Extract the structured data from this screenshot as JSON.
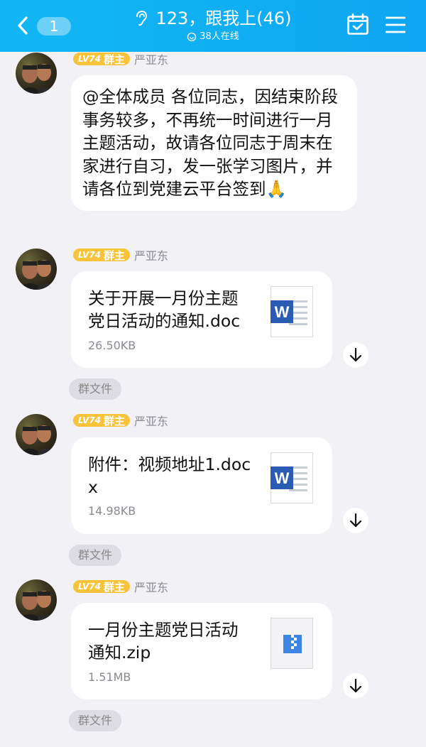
{
  "header": {
    "back_count": "1",
    "group_title": "123，跟我上(46)",
    "online_text": "38人在线"
  },
  "messages": [
    {
      "level": "LV74",
      "role": "群主",
      "sender": "严亚东",
      "text": "@全体成员 各位同志，因结束阶段事务较多，不再统一时间进行一月主题活动，故请各位同志于周末在家进行自习，发一张学习图片，并请各位到党建云平台签到🙏"
    },
    {
      "level": "LV74",
      "role": "群主",
      "sender": "严亚东",
      "file_name": "关于开展一月份主题党日活动的通知.doc",
      "file_size": "26.50KB",
      "file_icon": "word-doc-icon",
      "tag": "群文件"
    },
    {
      "level": "LV74",
      "role": "群主",
      "sender": "严亚东",
      "file_name": "附件：视频地址1.docx",
      "file_size": "14.98KB",
      "file_icon": "word-doc-icon",
      "tag": "群文件"
    },
    {
      "level": "LV74",
      "role": "群主",
      "sender": "严亚东",
      "file_name": "一月份主题党日活动通知.zip",
      "file_size": "1.51MB",
      "file_icon": "zip-file-icon",
      "tag": "群文件"
    }
  ],
  "colors": {
    "header": "#12b8f4",
    "level_badge": "#f7c33b",
    "word_blue": "#2b5cb3"
  }
}
